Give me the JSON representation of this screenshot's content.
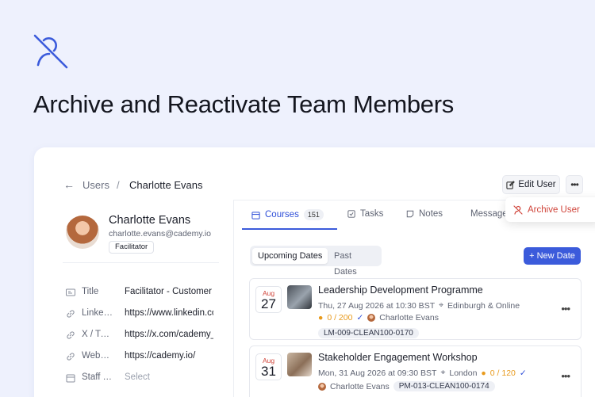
{
  "hero": {
    "title": "Archive and Reactivate Team Members",
    "icon": "user-off-icon"
  },
  "breadcrumb": {
    "root": "Users",
    "separator": "/",
    "current": "Charlotte Evans"
  },
  "header_actions": {
    "edit_label": "Edit User",
    "more_label": "•••"
  },
  "menu": {
    "archive_label": "Archive User"
  },
  "profile": {
    "name": "Charlotte Evans",
    "email": "charlotte.evans@cademy.io",
    "role": "Facilitator"
  },
  "fields": [
    {
      "icon": "id-icon",
      "label": "Title",
      "value": "Facilitator - Customer S"
    },
    {
      "icon": "link-icon",
      "label": "LinkedIn",
      "value": "https://www.linkedin.co"
    },
    {
      "icon": "link-icon",
      "label": "X / Twitter",
      "value": "https://x.com/cademy_"
    },
    {
      "icon": "link-icon",
      "label": "Website",
      "value": "https://cademy.io/"
    },
    {
      "icon": "calendar-icon",
      "label": "Staff Type",
      "value": "Select"
    }
  ],
  "tabs": [
    {
      "label": "Courses",
      "badge": "151",
      "icon": "calendar-icon"
    },
    {
      "label": "Tasks",
      "icon": "checkbox-icon"
    },
    {
      "label": "Notes",
      "icon": "note-icon"
    },
    {
      "label": "Messages",
      "icon": "mail-icon"
    }
  ],
  "segments": {
    "upcoming": "Upcoming Dates",
    "past": "Past Dates"
  },
  "new_date_label": "+ New Date",
  "courses": [
    {
      "month": "Aug",
      "day": "27",
      "title": "Leadership Development Programme",
      "datetime": "Thu, 27 Aug 2026 at 10:30 BST",
      "location": "Edinburgh & Online",
      "capacity": "0 / 200",
      "facilitator": "Charlotte Evans",
      "code": "LM-009-CLEAN100-0170"
    },
    {
      "month": "Aug",
      "day": "31",
      "title": "Stakeholder Engagement Workshop",
      "datetime": "Mon, 31 Aug 2026 at 09:30 BST",
      "location": "London",
      "capacity": "0 / 120",
      "facilitator": "Charlotte Evans",
      "code": "PM-013-CLEAN100-0174"
    }
  ],
  "colors": {
    "accent": "#3b5bdb",
    "danger": "#d0443a",
    "background": "#eef1fd"
  }
}
